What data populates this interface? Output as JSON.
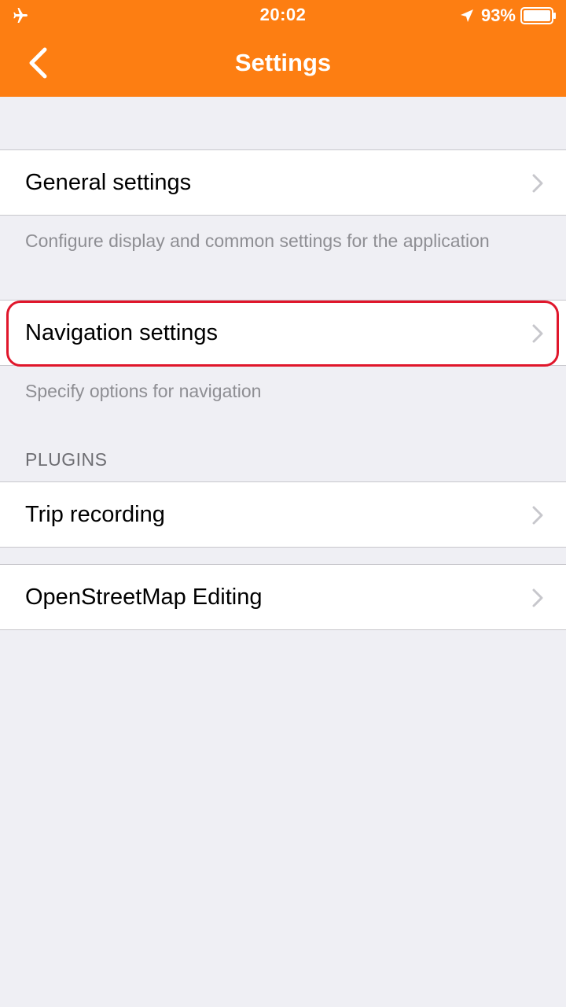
{
  "status_bar": {
    "time": "20:02",
    "battery_percent": "93%",
    "battery_level": 0.93,
    "airplane_icon": "airplane-icon",
    "location_icon": "location-arrow-icon"
  },
  "header": {
    "title": "Settings",
    "back_icon": "chevron-left-icon"
  },
  "items": [
    {
      "label": "General settings",
      "footer": "Configure display and common settings for the application"
    },
    {
      "label": "Navigation settings",
      "footer": "Specify options for navigation"
    }
  ],
  "plugins": {
    "header": "PLUGINS",
    "items": [
      {
        "label": "Trip recording"
      },
      {
        "label": "OpenStreetMap Editing"
      }
    ]
  },
  "colors": {
    "accent": "#fd7e12",
    "background": "#efeff4",
    "highlight": "#e0162b"
  }
}
